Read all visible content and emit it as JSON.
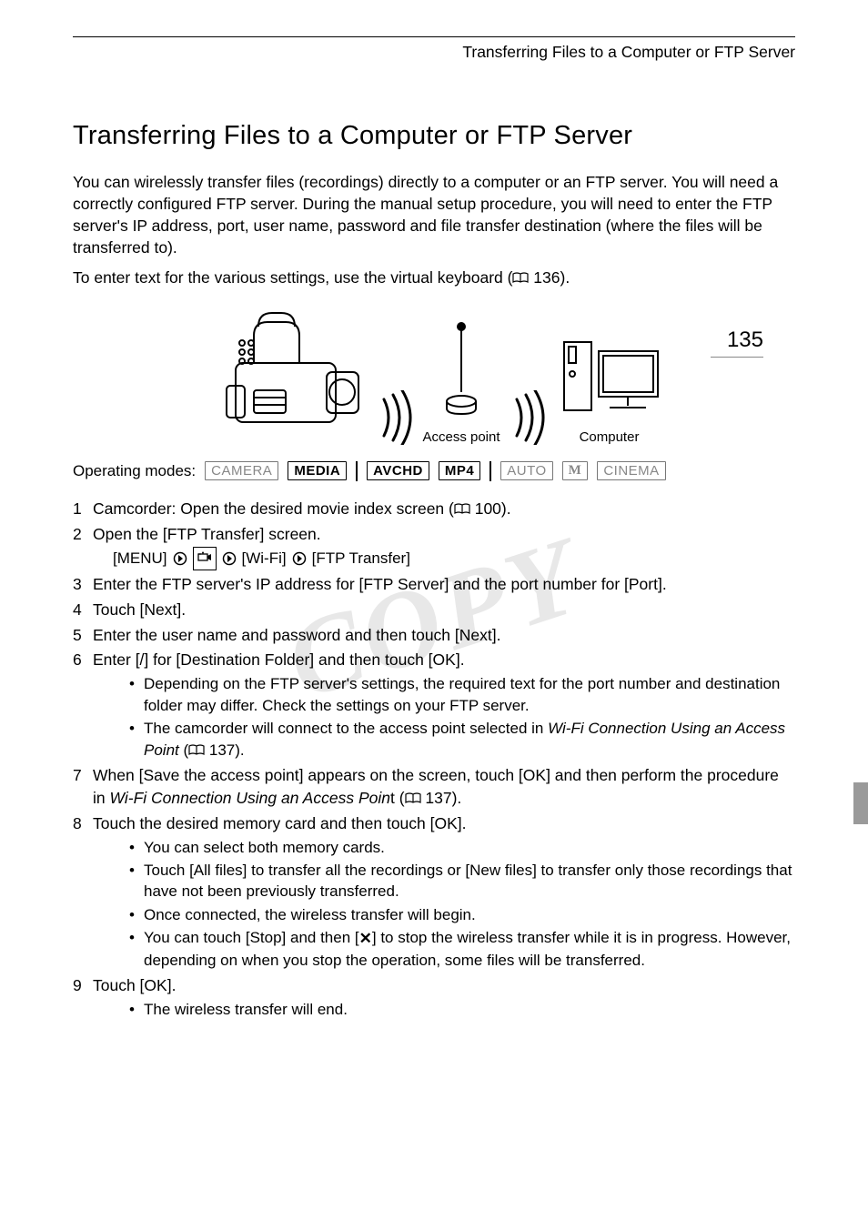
{
  "running_head": "Transferring Files to a Computer or FTP Server",
  "title": "Transferring Files to a Computer or FTP Server",
  "page_number": "135",
  "intro_p1": "You can wirelessly transfer files (recordings) directly to a computer or an FTP server. You will need a correctly configured FTP server. During the manual setup procedure, you will need to enter the FTP server's IP address, port, user name, password and file transfer destination (where the files will be transferred to).",
  "intro_p2_a": "To enter text for the various settings, use the virtual keyboard (",
  "intro_p2_b": " 136).",
  "diagram": {
    "access_point": "Access point",
    "computer": "Computer"
  },
  "operating_modes_label": "Operating modes:",
  "modes": {
    "camera": "CAMERA",
    "media": "MEDIA",
    "avchd": "AVCHD",
    "mp4": "MP4",
    "auto": "AUTO",
    "m": "M",
    "cinema": "CINEMA"
  },
  "steps": {
    "s1a": "Camcorder: Open the desired movie index screen (",
    "s1b": " 100).",
    "s2": "Open the [FTP Transfer] screen.",
    "s2_path": {
      "menu": "[MENU]",
      "wifi": "[Wi-Fi]",
      "ftp": "[FTP Transfer]"
    },
    "s3": "Enter the FTP server's IP address for [FTP Server] and the port number for [Port].",
    "s4": "Touch [Next].",
    "s5": "Enter the user name and password and then touch [Next].",
    "s6": "Enter [/] for [Destination Folder] and then touch [OK].",
    "s6_b1": "Depending on the FTP server's settings, the required text for the port number and destination folder may differ. Check the settings on your FTP server.",
    "s6_b2a": "The camcorder will connect to the access point selected in ",
    "s6_b2b": "Wi-Fi Connection Using an Access Point",
    "s6_b2c": " (",
    "s6_b2d": " 137).",
    "s7a": "When [Save the access point] appears on the screen, touch [OK] and then perform the procedure in ",
    "s7b": "Wi-Fi Connection Using an Access Poin",
    "s7c": "t (",
    "s7d": " 137).",
    "s8": "Touch the desired memory card and then touch [OK].",
    "s8_b1": "You can select both memory cards.",
    "s8_b2": "Touch [All files] to transfer all the recordings or [New files] to transfer only those recordings that have not been previously transferred.",
    "s8_b3": "Once connected, the wireless transfer will begin.",
    "s8_b4a": "You can touch [Stop] and then [",
    "s8_b4b": "] to stop the wireless transfer while it is in progress. However, depending on when you stop the operation, some files will be transferred.",
    "s9": "Touch [OK].",
    "s9_b1": "The wireless transfer will end."
  },
  "watermark": "COPY"
}
